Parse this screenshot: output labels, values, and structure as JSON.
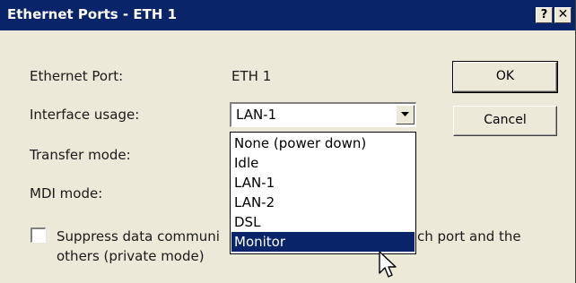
{
  "window": {
    "title": "Ethernet Ports - ETH 1",
    "help_label": "?",
    "close_label": "✕"
  },
  "fields": {
    "port_label": "Ethernet Port:",
    "port_value": "ETH 1",
    "usage_label": "Interface usage:",
    "transfer_label": "Transfer mode:",
    "mdi_label": "MDI mode:"
  },
  "combo": {
    "selected": "LAN-1",
    "options": [
      "None (power down)",
      "Idle",
      "LAN-1",
      "LAN-2",
      "DSL",
      "Monitor"
    ],
    "highlighted": "Monitor"
  },
  "checkbox": {
    "line1_left": "Suppress data communi",
    "line1_right": "ch port and the",
    "line2": "others (private mode)",
    "checked": false
  },
  "buttons": {
    "ok_label": "OK",
    "cancel_label": "Cancel"
  },
  "colors": {
    "titlebar": "#0a246a",
    "face": "#ece9d8",
    "selection": "#0a246a"
  }
}
